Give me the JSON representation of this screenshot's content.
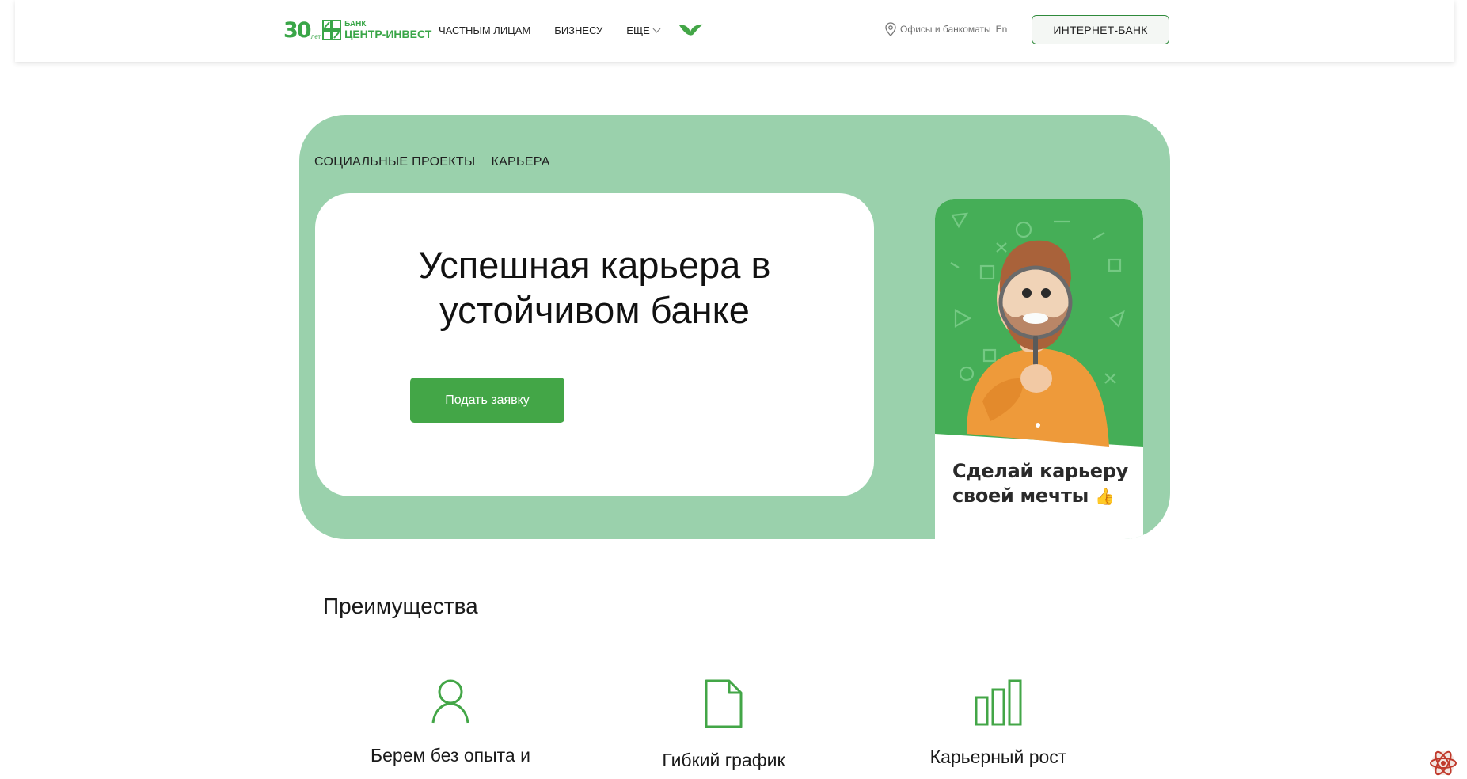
{
  "header": {
    "logo": {
      "anniversary": "30",
      "years": "лет",
      "bank_word": "БАНК",
      "bank_name": "ЦЕНТР-ИНВЕСТ"
    },
    "nav": [
      {
        "label": "ЧАСТНЫМ ЛИЦАМ"
      },
      {
        "label": "БИЗНЕСУ"
      },
      {
        "label": "ЕЩЕ",
        "has_dropdown": true
      }
    ],
    "offices_label": "Офисы и банкоматы",
    "lang_label": "En",
    "internet_bank_label": "ИНТЕРНЕТ-БАНК"
  },
  "hero": {
    "breadcrumbs": [
      "СОЦИАЛЬНЫЕ ПРОЕКТЫ",
      "КАРЬЕРА"
    ],
    "title_line1": "Успешная карьера в",
    "title_line2": "устойчивом банке",
    "apply_label": "Подать заявку",
    "promo_line1": "Сделай карьеру",
    "promo_line2": "своей мечты",
    "promo_emoji": "👍"
  },
  "advantages": {
    "title": "Преимущества",
    "items": [
      {
        "icon": "person-icon",
        "label": "Берем без опыта и"
      },
      {
        "icon": "document-icon",
        "label": "Гибкий график"
      },
      {
        "icon": "bar-chart-icon",
        "label": "Карьерный рост"
      }
    ]
  },
  "colors": {
    "brand_green": "#43a647",
    "hero_bg": "#9ad1ac",
    "promo_green": "#45ae57",
    "character_orange": "#ee9a3a"
  }
}
